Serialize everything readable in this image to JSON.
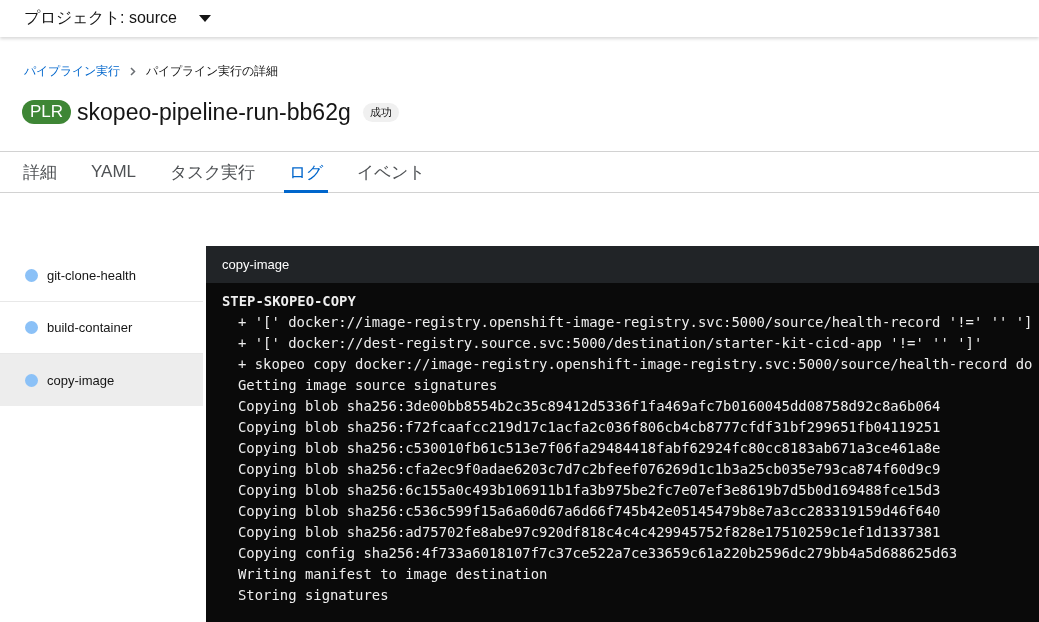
{
  "project_bar": {
    "label": "プロジェクト: source"
  },
  "breadcrumb": [
    {
      "label": "パイプライン実行",
      "link": true
    },
    {
      "label": "パイプライン実行の詳細",
      "link": false
    }
  ],
  "title": {
    "badge": "PLR",
    "name": "skopeo-pipeline-run-bb62g",
    "status": "成功"
  },
  "tabs": [
    {
      "label": "詳細",
      "selected": false
    },
    {
      "label": "YAML",
      "selected": false
    },
    {
      "label": "タスク実行",
      "selected": false
    },
    {
      "label": "ログ",
      "selected": true
    },
    {
      "label": "イベント",
      "selected": false
    }
  ],
  "tasks": [
    {
      "name": "git-clone-health",
      "selected": false
    },
    {
      "name": "build-container",
      "selected": false
    },
    {
      "name": "copy-image",
      "selected": true
    }
  ],
  "log": {
    "title": "copy-image",
    "lines": [
      {
        "kind": "step",
        "text": "STEP-SKOPEO-COPY"
      },
      {
        "kind": "line",
        "text": "+ '[' docker://image-registry.openshift-image-registry.svc:5000/source/health-record '!=' '' ']"
      },
      {
        "kind": "line",
        "text": "+ '[' docker://dest-registry.source.svc:5000/destination/starter-kit-cicd-app '!=' '' ']'"
      },
      {
        "kind": "line",
        "text": "+ skopeo copy docker://image-registry.openshift-image-registry.svc:5000/source/health-record do"
      },
      {
        "kind": "line",
        "text": "Getting image source signatures"
      },
      {
        "kind": "line",
        "text": "Copying blob sha256:3de00bb8554b2c35c89412d5336f1fa469afc7b0160045dd08758d92c8a6b064"
      },
      {
        "kind": "line",
        "text": "Copying blob sha256:f72fcaafcc219d17c1acfa2c036f806cb4cb8777cfdf31bf299651fb04119251"
      },
      {
        "kind": "line",
        "text": "Copying blob sha256:c530010fb61c513e7f06fa29484418fabf62924fc80cc8183ab671a3ce461a8e"
      },
      {
        "kind": "line",
        "text": "Copying blob sha256:cfa2ec9f0adae6203c7d7c2bfeef076269d1c1b3a25cb035e793ca874f60d9c9"
      },
      {
        "kind": "line",
        "text": "Copying blob sha256:6c155a0c493b106911b1fa3b975be2fc7e07ef3e8619b7d5b0d169488fce15d3"
      },
      {
        "kind": "line",
        "text": "Copying blob sha256:c536c599f15a6a60d67a6d66f745b42e05145479b8e7a3cc283319159d46f640"
      },
      {
        "kind": "line",
        "text": "Copying blob sha256:ad75702fe8abe97c920df818c4c4c429945752f828e17510259c1ef1d1337381"
      },
      {
        "kind": "line",
        "text": "Copying config sha256:4f733a6018107f7c37ce522a7ce33659c61a220b2596dc279bb4a5d688625d63"
      },
      {
        "kind": "line",
        "text": "Writing manifest to image destination"
      },
      {
        "kind": "line",
        "text": "Storing signatures"
      }
    ]
  }
}
